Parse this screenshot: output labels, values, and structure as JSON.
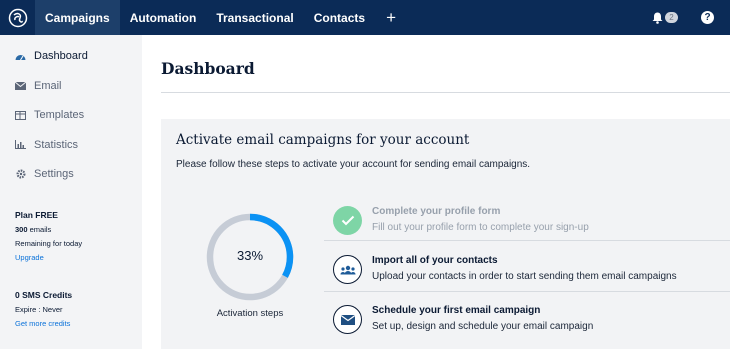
{
  "nav": {
    "items": [
      "Campaigns",
      "Automation",
      "Transactional",
      "Contacts"
    ],
    "plus": "+",
    "notifications_count": "2",
    "help": "?"
  },
  "sidebar": {
    "items": [
      {
        "label": "Dashboard",
        "icon": "dashboard-icon"
      },
      {
        "label": "Email",
        "icon": "envelope-icon"
      },
      {
        "label": "Templates",
        "icon": "templates-icon"
      },
      {
        "label": "Statistics",
        "icon": "bar-chart-icon"
      },
      {
        "label": "Settings",
        "icon": "gear-icon"
      }
    ],
    "plan": {
      "title": "Plan FREE",
      "emails_count": "300",
      "emails_unit": "emails",
      "remaining": "Remaining for today",
      "upgrade": "Upgrade"
    },
    "sms": {
      "title": "0 SMS Credits",
      "expire": "Expire : Never",
      "link": "Get more credits"
    }
  },
  "main": {
    "title": "Dashboard",
    "card": {
      "title": "Activate email campaigns for your account",
      "subtitle": "Please follow these steps to activate your account for sending email campaigns.",
      "progress": {
        "value": 0.33,
        "label_pct": "33%",
        "caption": "Activation steps"
      },
      "steps": [
        {
          "title": "Complete your profile form",
          "desc": "Fill out your profile form to complete your sign-up",
          "done": true,
          "icon": "check-icon"
        },
        {
          "title": "Import all of your contacts",
          "desc": "Upload your contacts in order to start sending them email campaigns",
          "done": false,
          "icon": "contacts-icon"
        },
        {
          "title": "Schedule your first email campaign",
          "desc": "Set up, design and schedule your email campaign",
          "done": false,
          "icon": "envelope-icon"
        }
      ]
    }
  },
  "colors": {
    "nav_bg": "#0b2b57",
    "accent": "#0b72d9",
    "ring_fill": "#0b92f4",
    "ring_track": "#c6ccd6",
    "done_green": "#7ed5a6"
  }
}
